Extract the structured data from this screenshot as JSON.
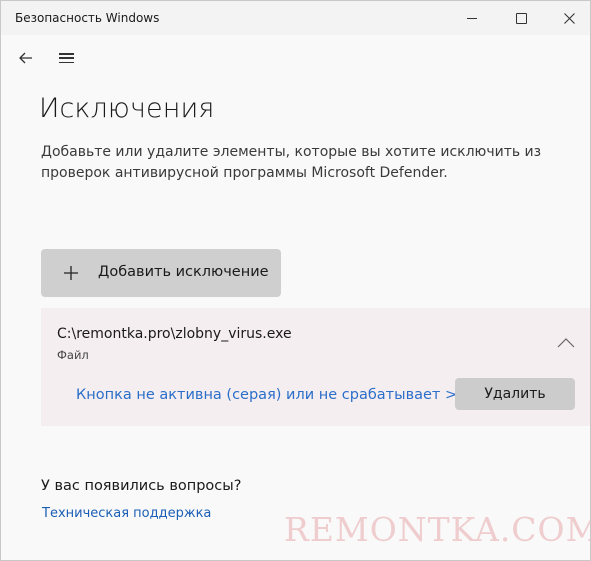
{
  "window": {
    "app_title": "Безопасность Windows"
  },
  "nav": {
    "back_icon": "back-arrow-icon",
    "menu_icon": "hamburger-menu-icon"
  },
  "page": {
    "title": "Исключения",
    "description": "Добавьте или удалите элементы, которые вы хотите исключить из проверок антивирусной программы Microsoft Defender."
  },
  "add_exclusion": {
    "label": "Добавить исключение",
    "icon": "plus-icon"
  },
  "exclusion": {
    "path": "C:\\remontka.pro\\zlobny_virus.exe",
    "type": "Файл",
    "note": "Кнопка не активна (серая) или не срабатывает >>",
    "delete_label": "Удалить",
    "expand_icon": "chevron-up-icon"
  },
  "questions": {
    "heading": "У вас появились вопросы?",
    "support_link": "Техническая поддержка"
  },
  "watermark": "REMONTKA.COM",
  "colors": {
    "accent_link": "#2a6ec9",
    "card_background": "#f5eef0",
    "button_disabled": "#cccccc",
    "watermark": "#efcdce"
  }
}
